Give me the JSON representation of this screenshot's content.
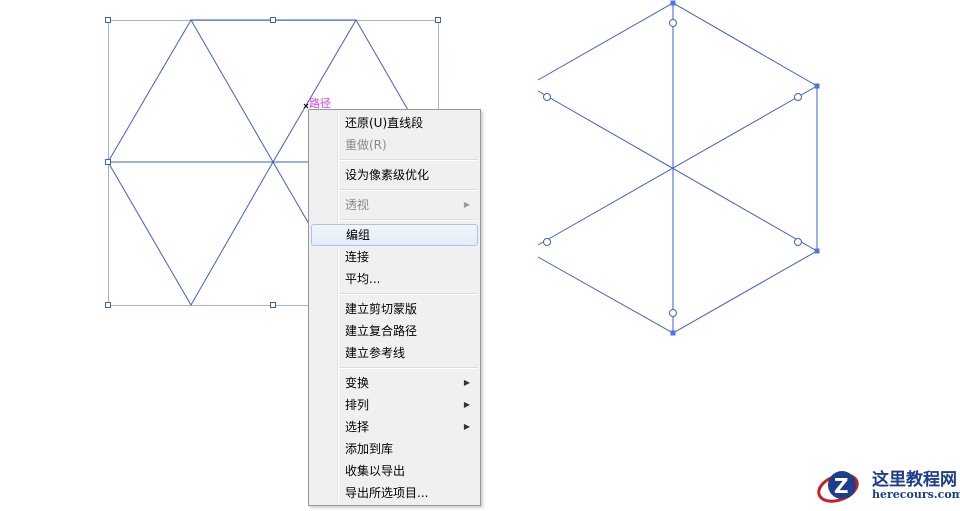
{
  "canvas": {
    "path_label": "路径",
    "stroke_color": "#3f5fc8"
  },
  "menu": {
    "items": [
      {
        "label": "还原(U)直线段",
        "disabled": false
      },
      {
        "label": "重做(R)",
        "disabled": true
      },
      {
        "sep": true
      },
      {
        "label": "设为像素级优化",
        "disabled": false
      },
      {
        "sep": true
      },
      {
        "label": "透视",
        "disabled": true,
        "submenu": true
      },
      {
        "sep": true
      },
      {
        "label": "编组",
        "highlighted": true
      },
      {
        "label": "连接"
      },
      {
        "label": "平均..."
      },
      {
        "sep": true
      },
      {
        "label": "建立剪切蒙版"
      },
      {
        "label": "建立复合路径"
      },
      {
        "label": "建立参考线"
      },
      {
        "sep": true
      },
      {
        "label": "变换",
        "submenu": true
      },
      {
        "label": "排列",
        "submenu": true
      },
      {
        "label": "选择",
        "submenu": true
      },
      {
        "label": "添加到库"
      },
      {
        "label": "收集以导出"
      },
      {
        "label": "导出所选项目..."
      }
    ]
  },
  "watermark": {
    "name": "这里教程网",
    "url": "herecours.com"
  }
}
